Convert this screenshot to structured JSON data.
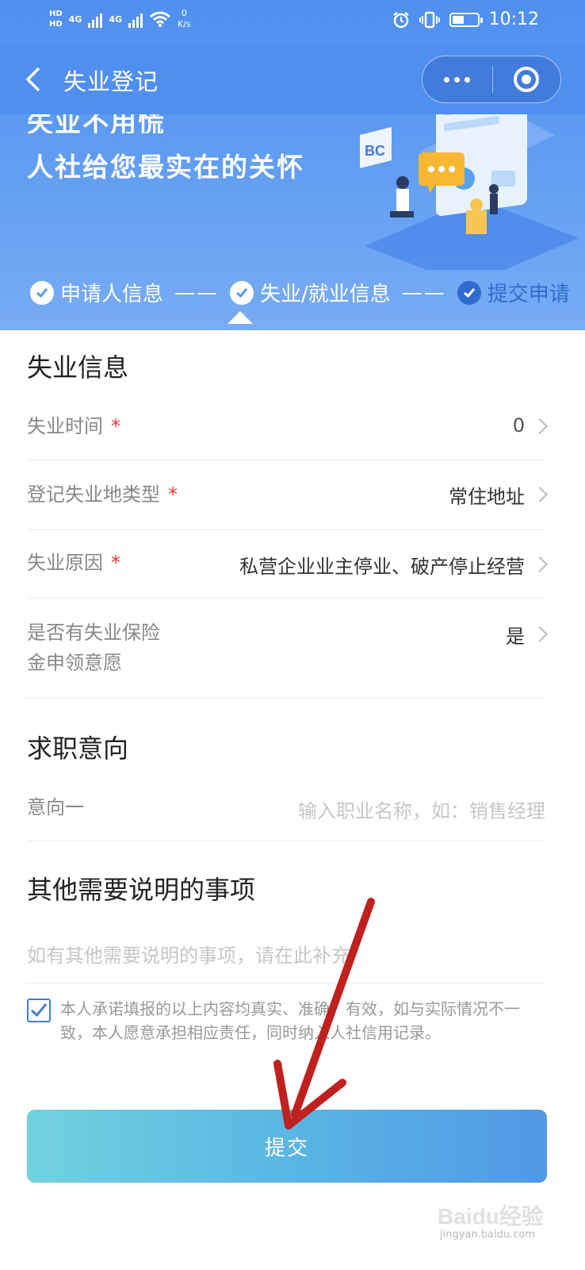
{
  "status_bar": {
    "hd1": "HD",
    "hd2": "HD",
    "net1": "4G",
    "net2": "4G",
    "speed_value": "0",
    "speed_unit": "K/s",
    "time": "10:12"
  },
  "nav": {
    "title": "失业登记"
  },
  "banner": {
    "slogan_line1": "失业不用慌",
    "slogan_line2": "人社给您最实在的关怀",
    "illustration_label": "BC"
  },
  "steps": [
    {
      "label": "申请人信息",
      "state": "done"
    },
    {
      "label": "失业/就业信息",
      "state": "current"
    },
    {
      "label": "提交申请",
      "state": "pending"
    }
  ],
  "step_separator": "——",
  "unemployment": {
    "section_title": "失业信息",
    "rows": [
      {
        "label": "失业时间",
        "required": true,
        "value": "0"
      },
      {
        "label": "登记失业地类型",
        "required": true,
        "value": "常住地址"
      },
      {
        "label": "失业原因",
        "required": true,
        "value": "私营企业业主停业、破产停止经营"
      },
      {
        "label_line1": "是否有失业保险",
        "label_line2": "金申领意愿",
        "required": false,
        "value": "是"
      }
    ]
  },
  "job_intent": {
    "section_title": "求职意向",
    "field_label": "意向一",
    "placeholder": "输入职业名称，如：销售经理"
  },
  "other_notes": {
    "section_title": "其他需要说明的事项",
    "placeholder": "如有其他需要说明的事项，请在此补充"
  },
  "consent": {
    "checked": true,
    "text": "本人承诺填报的以上内容均真实、准确、有效，如与实际情况不一致，本人愿意承担相应责任，同时纳入人社信用记录。"
  },
  "submit_label": "提交",
  "watermark": {
    "brand": "Baidu经验",
    "url": "jingyan.baidu.com"
  },
  "colors": {
    "primary": "#4f8ff0",
    "required_mark": "#e53935",
    "annotation_arrow": "#c0211f"
  }
}
